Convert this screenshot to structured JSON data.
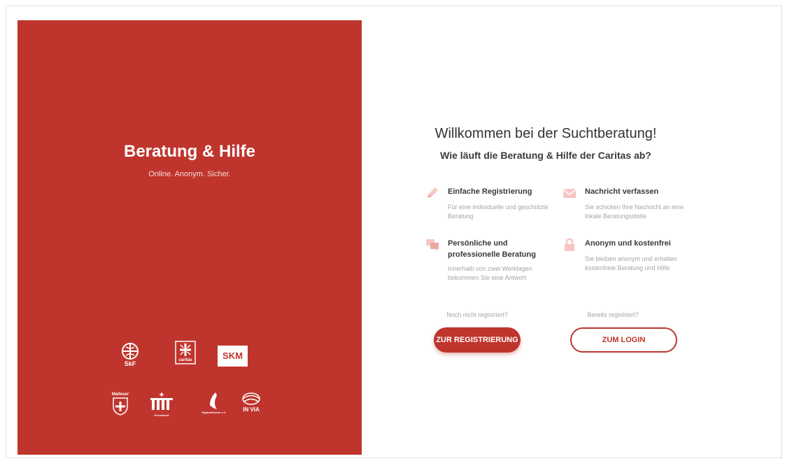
{
  "brand": {
    "title": "Beratung & Hilfe",
    "subtitle": "Online. Anonym. Sicher."
  },
  "logos": [
    {
      "name": "skf-logo",
      "text": "SkF"
    },
    {
      "name": "caritas-logo",
      "text": "caritas"
    },
    {
      "name": "skm-logo",
      "text": "SKM"
    },
    {
      "name": "malteser-logo",
      "text": "Malteser"
    },
    {
      "name": "kreuzbund-logo",
      "text": "Kreuzbund"
    },
    {
      "name": "raphaelswerk-logo",
      "text": "Raphaelswerk e.V."
    },
    {
      "name": "invia-logo",
      "text": "IN VIA"
    }
  ],
  "welcome": {
    "title": "Willkommen bei der Suchtberatung!",
    "subtitle": "Wie läuft die Beratung & Hilfe der Caritas ab?"
  },
  "features": [
    {
      "icon": "pencil-icon",
      "title": "Einfache Registrierung",
      "description": "Für eine individuelle und geschützte Beratung"
    },
    {
      "icon": "envelope-icon",
      "title": "Nachricht verfassen",
      "description": "Sie schicken Ihre Nachricht an eine lokale Beratungsstelle"
    },
    {
      "icon": "chat-icon",
      "title": "Persönliche und professionelle Beratung",
      "description": "Innerhalb von zwei Werktagen bekommen Sie eine Antwort"
    },
    {
      "icon": "lock-icon",
      "title": "Anonym und kostenfrei",
      "description": "Sie bleiben anonym und erhalten kostenfreie Beratung und Hilfe"
    }
  ],
  "cta": {
    "register_question": "Noch nicht registriert?",
    "register_label": "ZUR REGISTRIERUNG",
    "login_question": "Bereits registriert?",
    "login_label": "ZUM LOGIN"
  },
  "colors": {
    "brand_red": "#bf352d",
    "icon_pink": "#f4c7c4"
  }
}
